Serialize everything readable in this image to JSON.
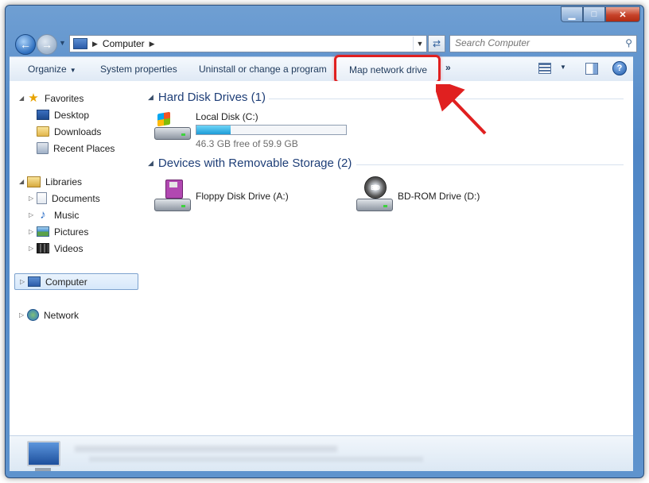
{
  "window": {
    "caption_buttons": [
      "minimize",
      "maximize",
      "close"
    ]
  },
  "address_bar": {
    "location": "Computer",
    "search_placeholder": "Search Computer"
  },
  "toolbar": {
    "organize_label": "Organize",
    "system_properties_label": "System properties",
    "uninstall_label": "Uninstall or change a program",
    "map_network_drive_label": "Map network drive",
    "more_label": "»",
    "help_label": "?"
  },
  "sidebar": {
    "favorites": {
      "label": "Favorites",
      "items": [
        "Desktop",
        "Downloads",
        "Recent Places"
      ]
    },
    "libraries": {
      "label": "Libraries",
      "items": [
        "Documents",
        "Music",
        "Pictures",
        "Videos"
      ]
    },
    "computer_label": "Computer",
    "network_label": "Network"
  },
  "groups": {
    "hard_disk": {
      "title": "Hard Disk Drives (1)"
    },
    "removable": {
      "title": "Devices with Removable Storage (2)"
    }
  },
  "drives": {
    "local_c": {
      "name": "Local Disk (C:)",
      "free_text": "46.3 GB free of 59.9 GB",
      "used_fraction": 0.227
    },
    "floppy_a": {
      "name": "Floppy Disk Drive (A:)"
    },
    "bdrom_d": {
      "name": "BD-ROM Drive (D:)",
      "disc_badge": "BD"
    }
  },
  "annotation": {
    "highlight_color": "#e02020"
  }
}
